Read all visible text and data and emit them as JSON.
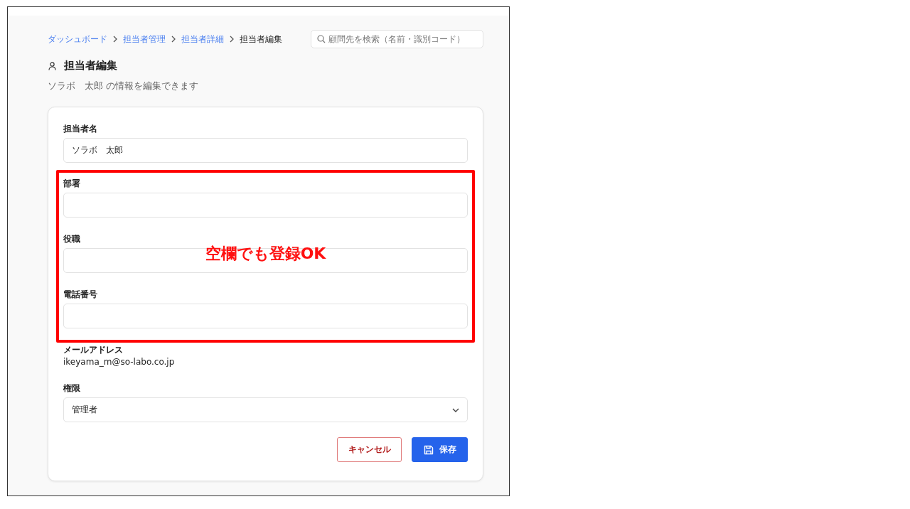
{
  "breadcrumb": [
    {
      "label": "ダッシュボード",
      "kind": "link"
    },
    {
      "label": "担当者管理",
      "kind": "link"
    },
    {
      "label": "担当者詳細",
      "kind": "link"
    },
    {
      "label": "担当者編集",
      "kind": "current"
    }
  ],
  "search": {
    "placeholder": "顧問先を検索（名前・識別コード）"
  },
  "title": "担当者編集",
  "subtitle": "ソラボ　太郎 の情報を編集できます",
  "form": {
    "fields_before": [
      {
        "label": "担当者名",
        "kind": "input",
        "value": "ソラボ　太郎"
      }
    ],
    "annotation": {
      "note": "空欄でも登録OK",
      "fields": [
        {
          "label": "部署",
          "kind": "input"
        },
        {
          "label": "役職",
          "kind": "input"
        },
        {
          "label": "電話番号",
          "kind": "input"
        }
      ]
    },
    "fields_after": [
      {
        "label": "メールアドレス",
        "kind": "static",
        "value": "ikeyama_m@so-labo.co.jp"
      },
      {
        "label": "権限",
        "kind": "select",
        "value": "管理者"
      }
    ]
  },
  "buttons": [
    {
      "label": "キャンセル",
      "kind": "cancel"
    },
    {
      "label": "保存",
      "kind": "save"
    }
  ]
}
